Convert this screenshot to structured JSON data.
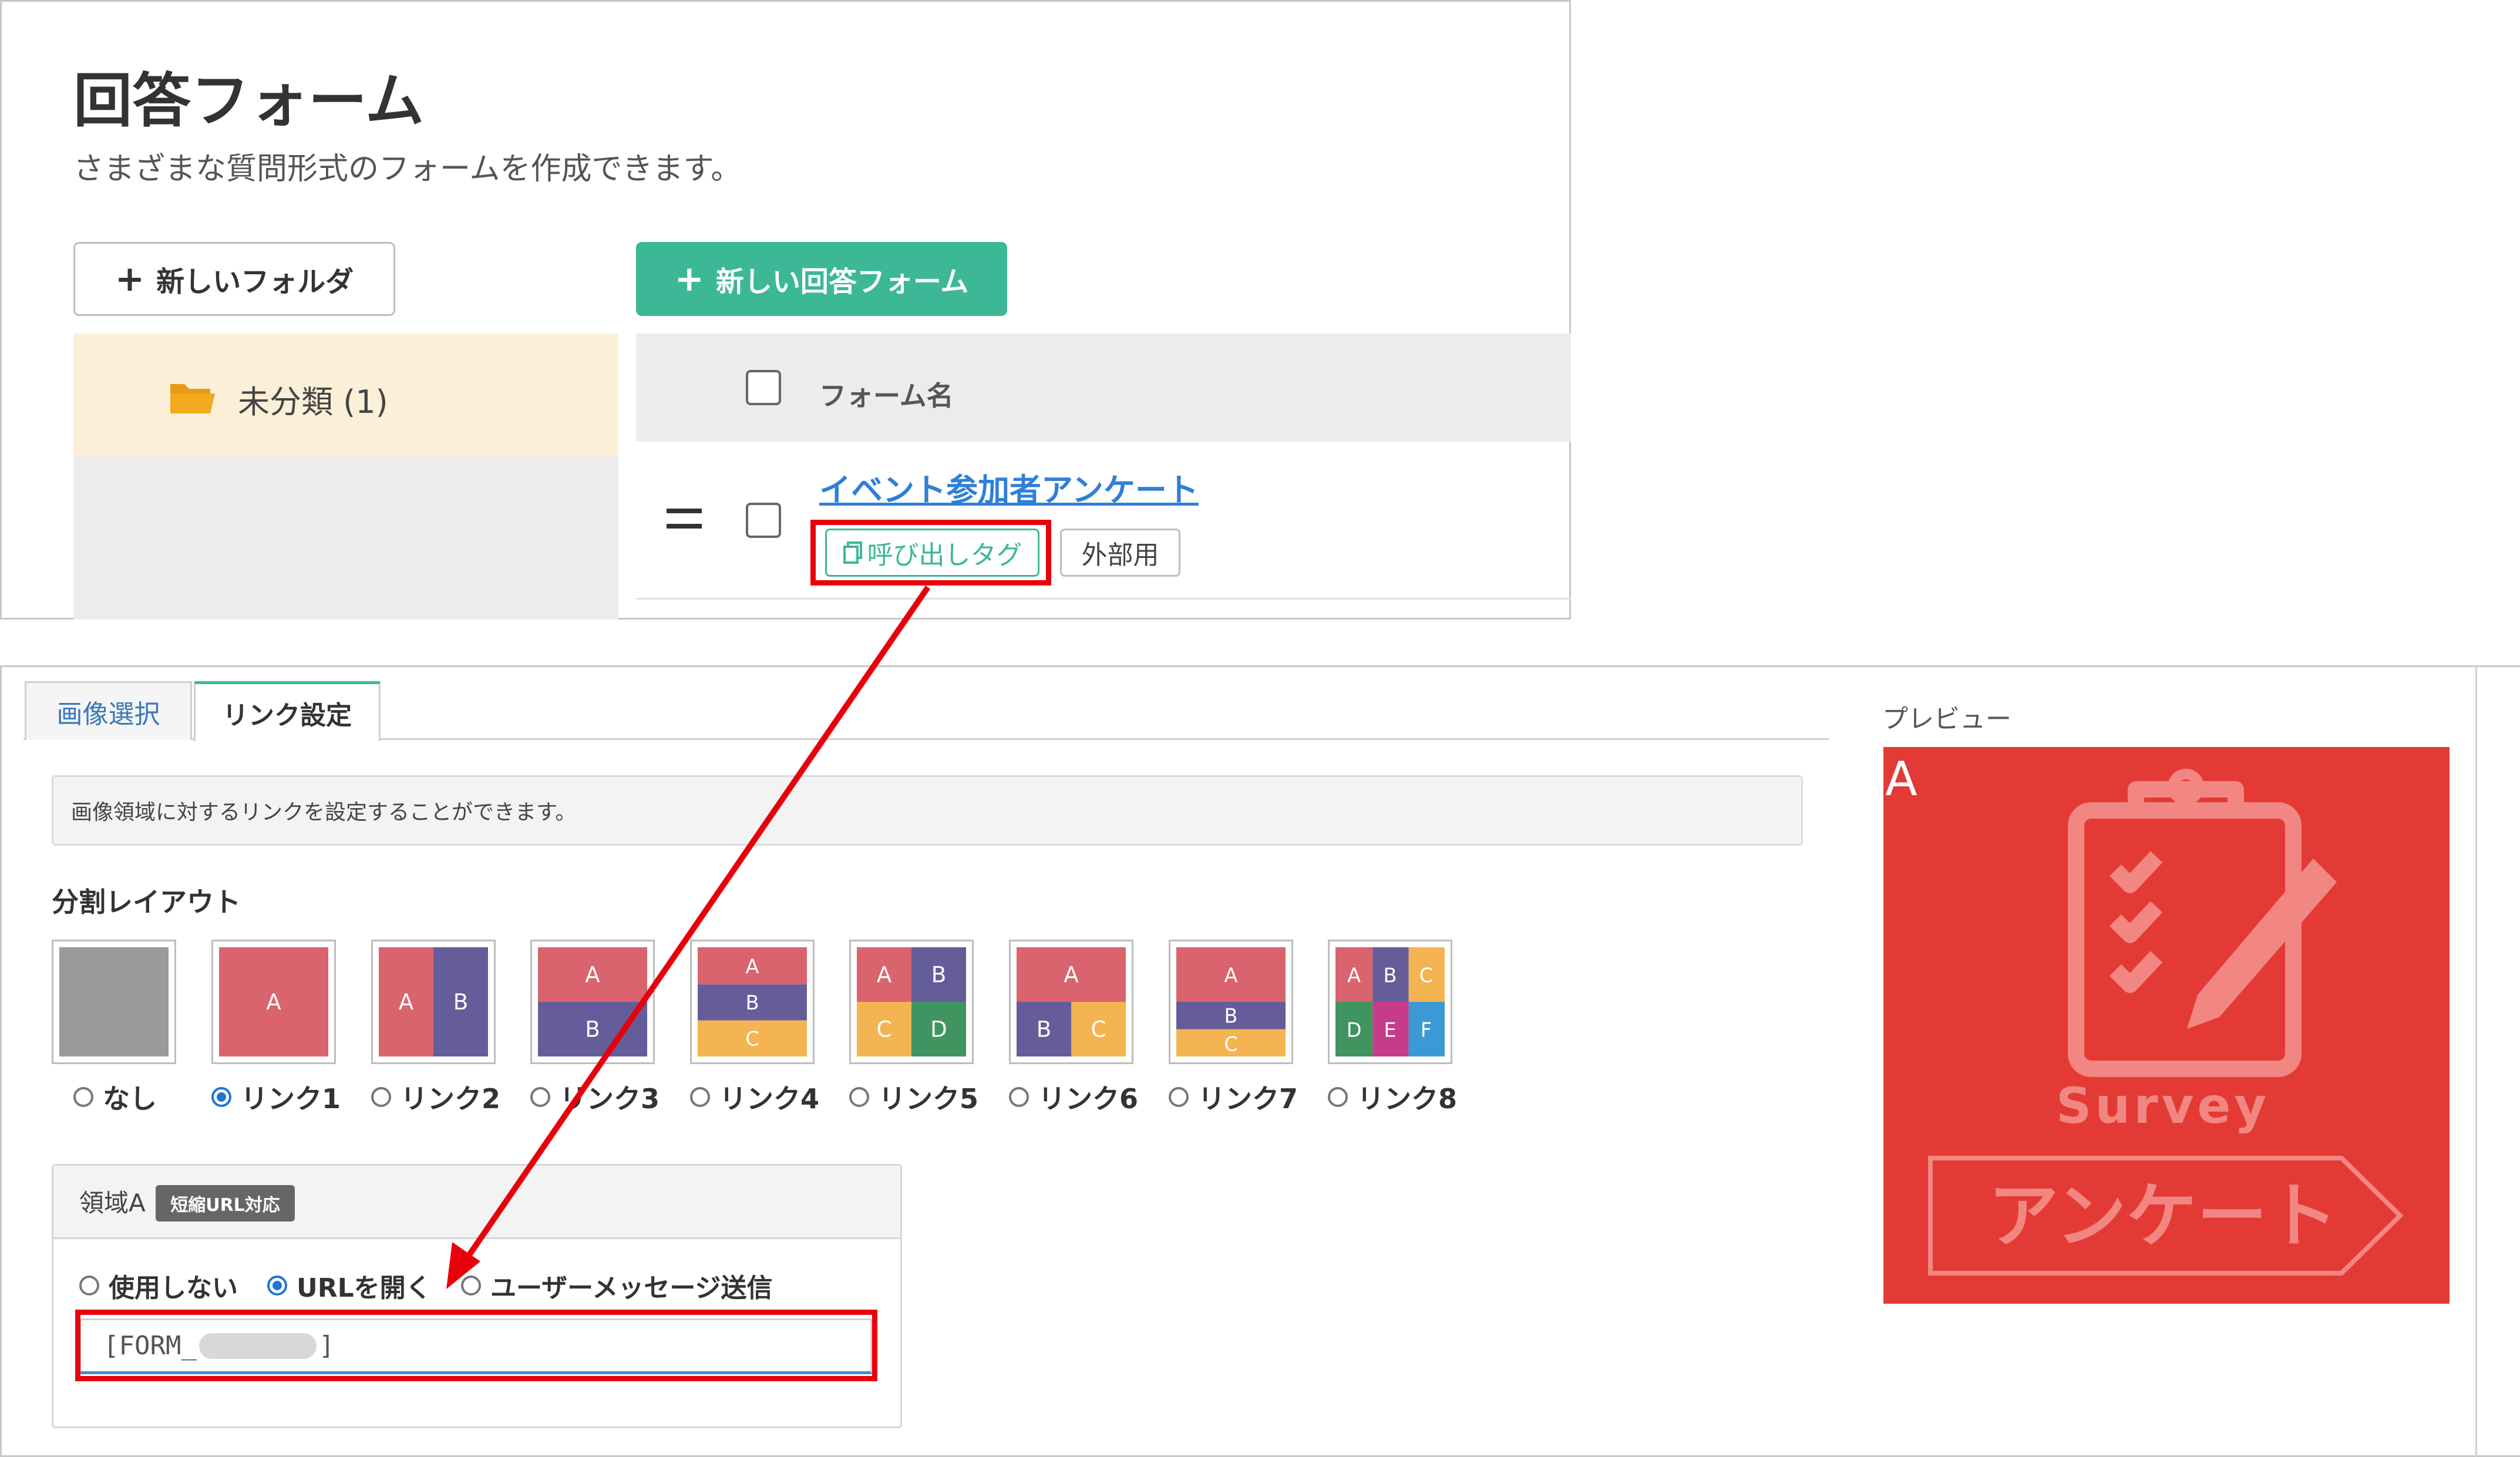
{
  "form_list": {
    "title": "回答フォーム",
    "subtitle": "さまざまな質問形式のフォームを作成できます。",
    "new_folder_label": "新しいフォルダ",
    "new_form_label": "新しい回答フォーム",
    "folder": {
      "label": "未分類 (1)"
    },
    "table": {
      "header_label": "フォーム名",
      "rows": [
        {
          "name": "イベント参加者アンケート",
          "call_tag_label": "呼び出しタグ",
          "external_label": "外部用"
        }
      ]
    }
  },
  "editor": {
    "tabs": [
      {
        "label": "画像選択"
      },
      {
        "label": "リンク設定"
      }
    ],
    "active_tab": "リンク設定",
    "info_text": "画像領域に対するリンクを設定することができます。",
    "layout_heading": "分割レイアウト",
    "layout_options": [
      {
        "label": "なし",
        "selected": false,
        "cells": []
      },
      {
        "label": "リンク1",
        "selected": true,
        "cells": [
          "A"
        ]
      },
      {
        "label": "リンク2",
        "selected": false,
        "cells": [
          "A",
          "B"
        ]
      },
      {
        "label": "リンク3",
        "selected": false,
        "cells": [
          "A",
          "B"
        ]
      },
      {
        "label": "リンク4",
        "selected": false,
        "cells": [
          "A",
          "B",
          "C"
        ]
      },
      {
        "label": "リンク5",
        "selected": false,
        "cells": [
          "A",
          "B",
          "C",
          "D"
        ]
      },
      {
        "label": "リンク6",
        "selected": false,
        "cells": [
          "A",
          "B",
          "C"
        ]
      },
      {
        "label": "リンク7",
        "selected": false,
        "cells": [
          "A",
          "B",
          "C"
        ]
      },
      {
        "label": "リンク8",
        "selected": false,
        "cells": [
          "A",
          "B",
          "C",
          "D",
          "E",
          "F"
        ]
      }
    ],
    "area": {
      "label": "領域A",
      "badge": "短縮URL対応",
      "action_options": [
        {
          "label": "使用しない",
          "selected": false
        },
        {
          "label": "URLを開く",
          "selected": true
        },
        {
          "label": "ユーザーメッセージ送信",
          "selected": false
        }
      ],
      "url_prefix": "[FORM_",
      "url_suffix": "]"
    },
    "preview": {
      "label": "プレビュー",
      "region_letter": "A",
      "image_text_en": "Survey",
      "image_text_ja": "アンケート"
    }
  },
  "colors": {
    "accent_green": "#3cb897",
    "link_blue": "#2f7fd8",
    "callout_red": "#e8000b",
    "preview_red": "#e43a35",
    "cell_a": "#d9646d",
    "cell_b": "#645d99",
    "cell_c": "#f4b452",
    "cell_d": "#3f9460",
    "cell_e": "#c63c8a",
    "cell_f": "#3b9ad6",
    "cell_none": "#9a9a9a"
  }
}
